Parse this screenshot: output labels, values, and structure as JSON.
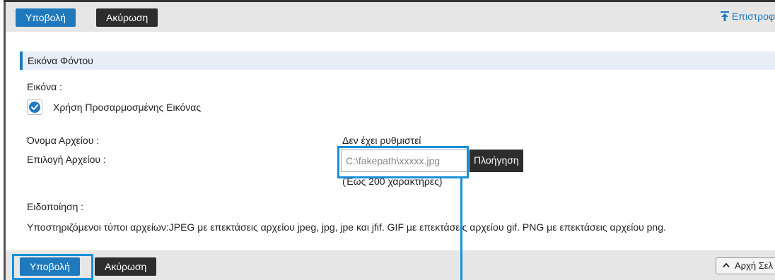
{
  "toolbar": {
    "submit_label": "Υποβολή",
    "cancel_label": "Ακύρωση",
    "return_label": "Επιστροφ",
    "return_icon": "return-arrow-icon"
  },
  "section": {
    "title": "Εικόνα Φόντου",
    "image_label": "Εικόνα :",
    "use_custom_label": "Χρήση Προσαρμοσμένης Εικόνας",
    "use_custom_checked": true,
    "file_name_label": "Όνομα Αρχείου :",
    "file_name_value": "Δεν έχει ρυθμιστεί",
    "file_select_label": "Επιλογή Αρχείου :",
    "file_input_value": "C:\\fakepath\\xxxxx.jpg",
    "browse_label": "Πλοήγηση",
    "max_chars_note": "(Έως 200 χαρακτήρες)",
    "notice_label": "Ειδοποίηση :",
    "notice_text": "Υποστηριζόμενοι τύποι αρχείων:JPEG με επεκτάσεις αρχείου jpeg, jpg, jpe και jfif. GIF με επεκτάσεις αρχείου gif. PNG με επεκτάσεις αρχείου png."
  },
  "footer": {
    "submit_label": "Υποβολή",
    "cancel_label": "Ακύρωση",
    "top_label": "Αρχή Σελ"
  },
  "colors": {
    "accent": "#1f79bd",
    "highlight": "#1890d8",
    "dark_button": "#2d2d2d"
  }
}
